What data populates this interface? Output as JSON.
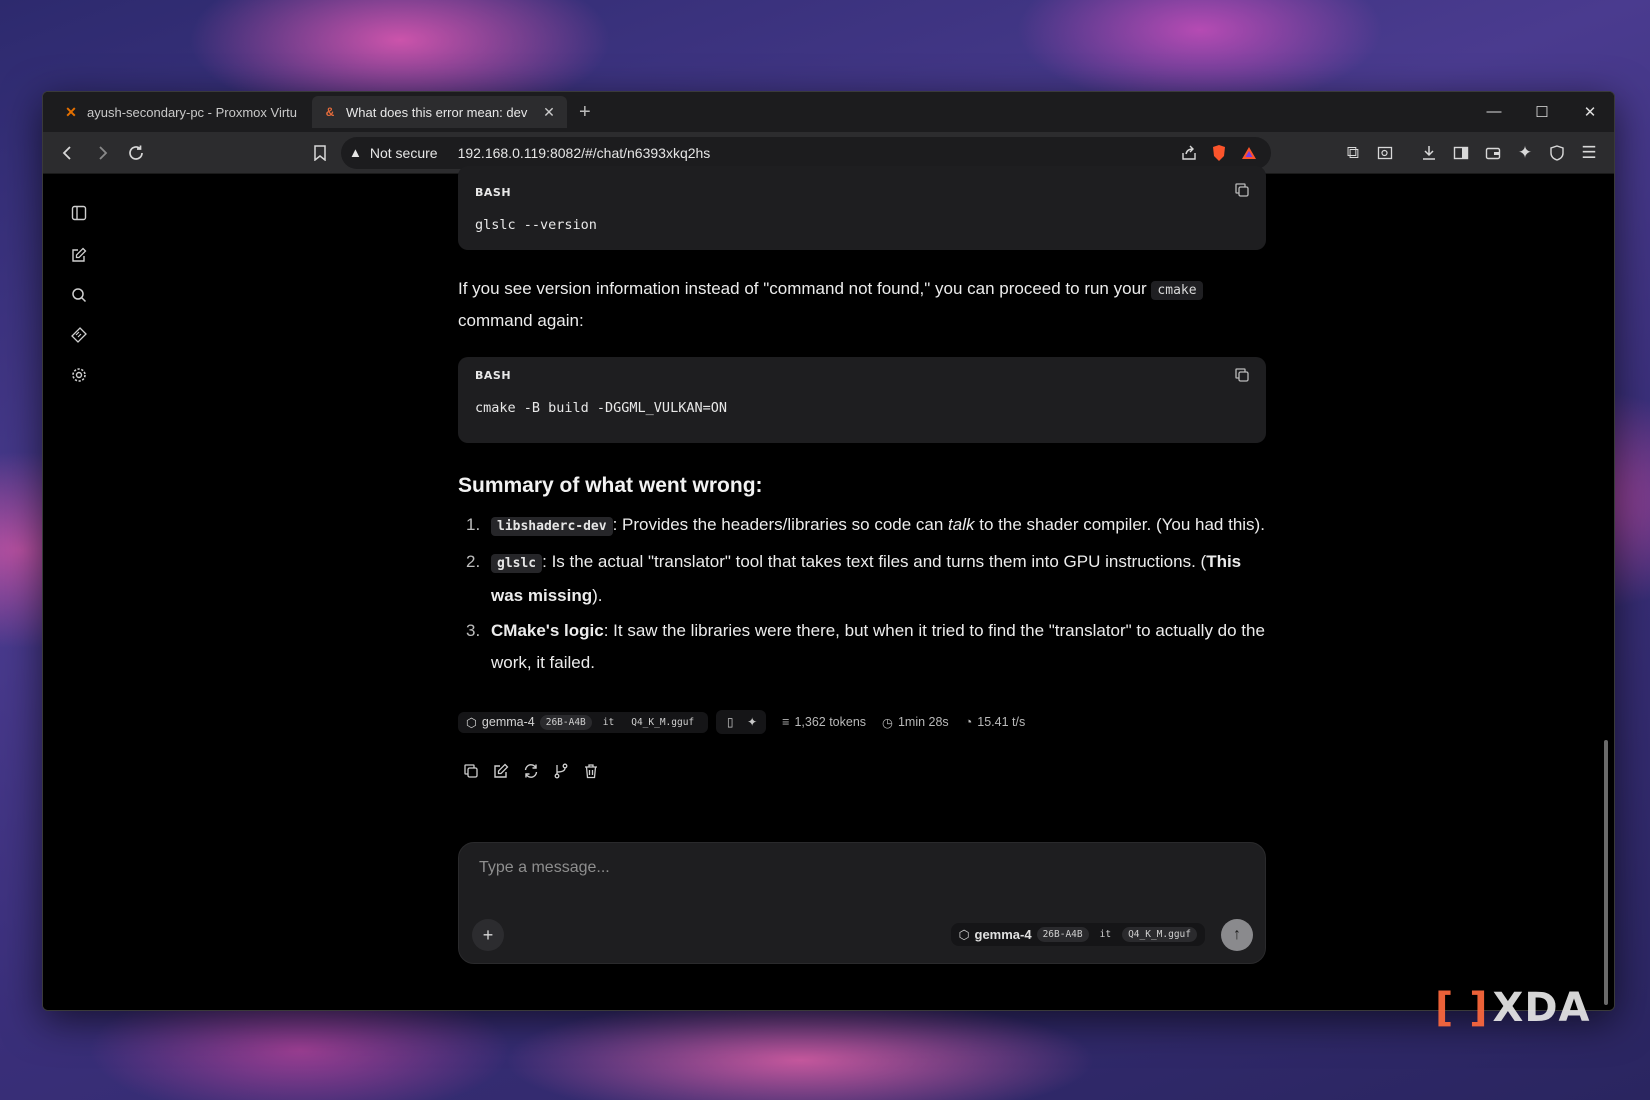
{
  "browser": {
    "tabs": [
      {
        "title": "ayush-secondary-pc - Proxmox Virtu",
        "active": false
      },
      {
        "title": "What does this error mean: dev",
        "active": true
      }
    ],
    "new_tab": "+",
    "security_label": "Not secure",
    "url": "192.168.0.119:8082/#/chat/n6393xkq2hs"
  },
  "chat": {
    "code1": {
      "lang": "BASH",
      "code": "glslc --version"
    },
    "para1": {
      "before": "If you see version information instead of \"command not found,\" you can proceed to run your",
      "code": "cmake",
      "after": "command again:"
    },
    "code2": {
      "lang": "BASH",
      "code": "cmake -B build -DGGML_VULKAN=ON"
    },
    "summary_heading": "Summary of what went wrong:",
    "items": [
      {
        "num": "1.",
        "code": "libshaderc-dev",
        "text_a": ": Provides the headers/libraries so code can ",
        "italic": "talk",
        "text_b": " to the shader compiler. (You had this)."
      },
      {
        "num": "2.",
        "code": "glslc",
        "text_a": ": Is the actual \"translator\" tool that takes text files and turns them into GPU instructions. (",
        "bold": "This was missing",
        "text_b": ")."
      },
      {
        "num": "3.",
        "bold_lead": "CMake's logic",
        "text_a": ": It saw the libraries were there, but when it tried to find the \"translator\" to actually do the work, it failed."
      }
    ],
    "meta": {
      "model_name": "gemma-4",
      "model_size": "26B-A4B",
      "model_variant": "it",
      "model_file": "Q4_K_M.gguf",
      "tokens": "1,362 tokens",
      "duration": "1min 28s",
      "speed": "15.41 t/s"
    }
  },
  "composer": {
    "placeholder": "Type a message...",
    "model_name": "gemma-4",
    "model_size": "26B-A4B",
    "model_variant": "it",
    "model_file": "Q4_K_M.gguf"
  },
  "watermark": "XDA",
  "colors": {
    "accent_orange": "#ff6a3d",
    "brave_orange": "#fb542b",
    "bg": "#000000",
    "code_bg": "#1e1e20"
  }
}
